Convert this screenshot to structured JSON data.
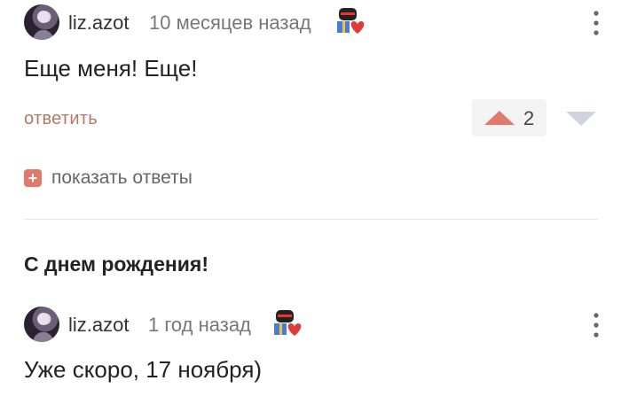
{
  "comments": [
    {
      "username": "liz.azot",
      "timestamp": "10 месяцев назад",
      "text": "Еще меня! Еще!",
      "reply_label": "ответить",
      "votes": "2",
      "show_replies_label": "показать ответы",
      "badge_icon": "gift-heart-badge-icon"
    },
    {
      "username": "liz.azot",
      "timestamp": "1 год назад",
      "text": "Уже скоро, 17 ноября)",
      "badge_icon": "gift-heart-badge-icon"
    }
  ],
  "section_title": "С днем рождения!",
  "colors": {
    "reply_link": "#b77667",
    "upvote": "#e07a6b",
    "downvote": "#cfd4de",
    "plus_box": "#e07a6b"
  }
}
